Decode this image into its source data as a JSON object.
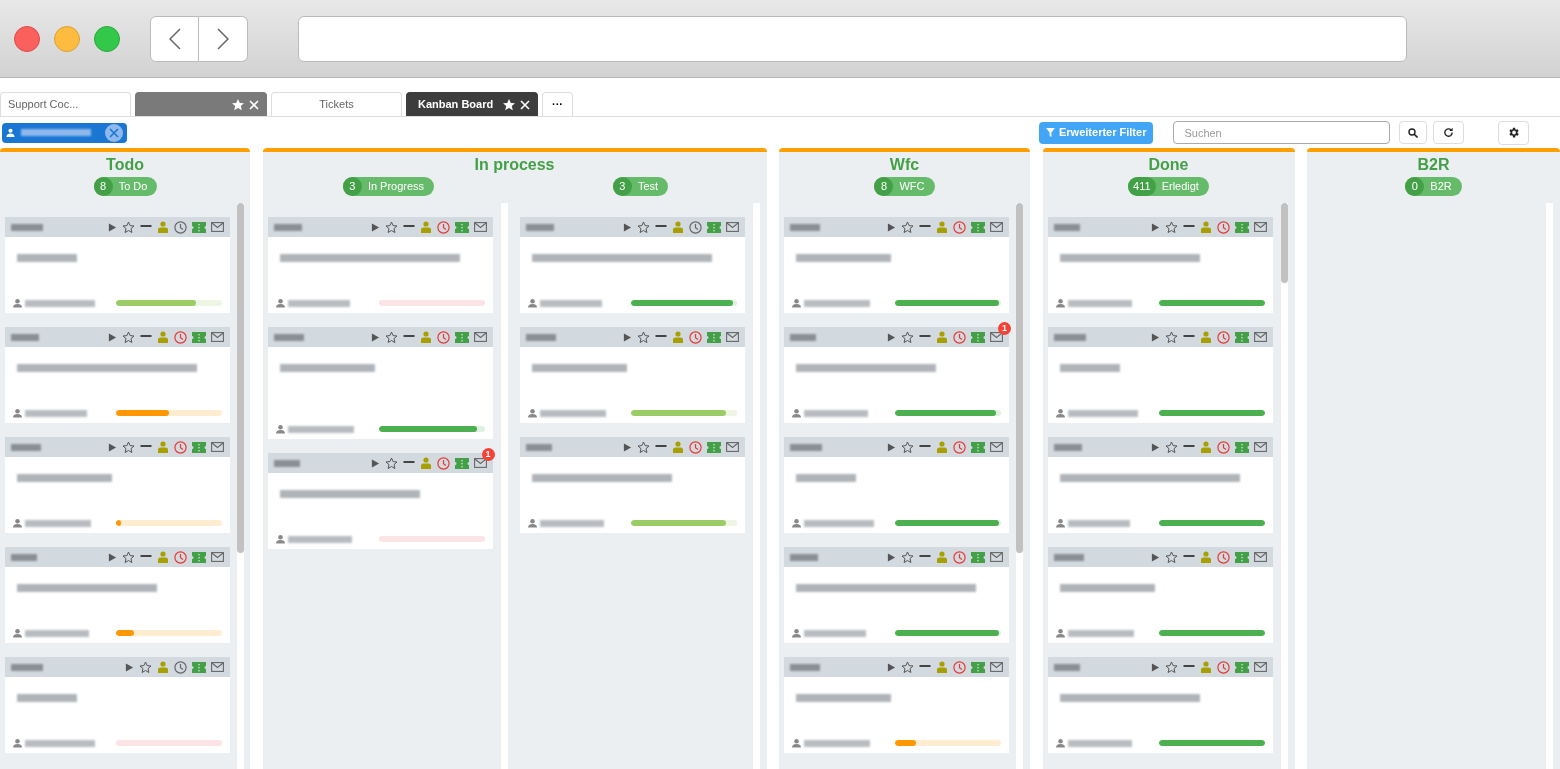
{
  "tabs": [
    {
      "label": "Support Coc...",
      "selected": false,
      "kind": "plain"
    },
    {
      "selected": false,
      "kind": "pinned"
    },
    {
      "label": "Tickets",
      "selected": false,
      "kind": "plain"
    },
    {
      "label": "Kanban Board",
      "selected": true,
      "kind": "pinned"
    },
    {
      "label": "···",
      "selected": false,
      "kind": "more"
    }
  ],
  "toolbar": {
    "filter_button": "Erweiterter Filter",
    "search": {
      "placeholder": "Suchen"
    }
  },
  "columns": [
    {
      "title": "Todo",
      "lanes": [
        {
          "count": "8",
          "label": "To Do",
          "cards": [
            {
              "kind": "normal",
              "overdue": false,
              "level": 0.75,
              "color": "#9ccc65"
            },
            {
              "kind": "normal",
              "overdue": true,
              "level": 0.5,
              "color": "#ff9800"
            },
            {
              "kind": "normal",
              "overdue": true,
              "level": 0.05,
              "color": "#ff9800"
            },
            {
              "kind": "normal",
              "overdue": true,
              "level": 0.17,
              "color": "#ff9800"
            },
            {
              "kind": "low",
              "overdue": false,
              "color": "#fce4e6"
            }
          ]
        }
      ]
    },
    {
      "title": "In process",
      "lanes": [
        {
          "count": "3",
          "label": "In Progress",
          "cards": [
            {
              "kind": "normal",
              "overdue": true,
              "color": "#fce4e6"
            },
            {
              "kind": "normal",
              "overdue": true,
              "level": 0.93,
              "color": "#4caf50"
            },
            {
              "kind": "normal",
              "overdue": true,
              "color": "#fce4e6",
              "mail_badge": "1"
            }
          ]
        },
        {
          "count": "3",
          "label": "Test",
          "cards": [
            {
              "kind": "normal",
              "overdue": false,
              "level": 0.97,
              "color": "#4caf50"
            },
            {
              "kind": "normal",
              "overdue": true,
              "level": 0.9,
              "color": "#9ccc65"
            },
            {
              "kind": "normal",
              "overdue": true,
              "level": 0.9,
              "color": "#9ccc65"
            }
          ]
        }
      ]
    },
    {
      "title": "Wfc",
      "lanes": [
        {
          "count": "8",
          "label": "WFC",
          "cards": [
            {
              "kind": "normal",
              "overdue": true,
              "level": 0.98,
              "color": "#4caf50"
            },
            {
              "kind": "normal",
              "overdue": true,
              "level": 0.95,
              "color": "#4caf50",
              "mail_badge": "1"
            },
            {
              "kind": "normal",
              "overdue": true,
              "level": 0.98,
              "color": "#4caf50"
            },
            {
              "kind": "normal",
              "overdue": true,
              "level": 0.98,
              "color": "#4caf50"
            },
            {
              "kind": "normal",
              "overdue": true,
              "level": 0.2,
              "color": "#ff9800"
            }
          ]
        }
      ]
    },
    {
      "title": "Done",
      "lanes": [
        {
          "count": "411",
          "label": "Erledigt",
          "cards": [
            {
              "kind": "normal",
              "overdue": true,
              "level": 1,
              "color": "#4caf50"
            },
            {
              "kind": "normal",
              "overdue": true,
              "level": 1,
              "color": "#4caf50"
            },
            {
              "kind": "normal",
              "overdue": true,
              "level": 1,
              "color": "#4caf50"
            },
            {
              "kind": "normal",
              "overdue": true,
              "level": 1,
              "color": "#4caf50"
            },
            {
              "kind": "normal",
              "overdue": true,
              "level": 1,
              "color": "#4caf50"
            }
          ]
        }
      ]
    },
    {
      "title": "B2R",
      "lanes": [
        {
          "count": "0",
          "label": "B2R"
        }
      ]
    }
  ]
}
